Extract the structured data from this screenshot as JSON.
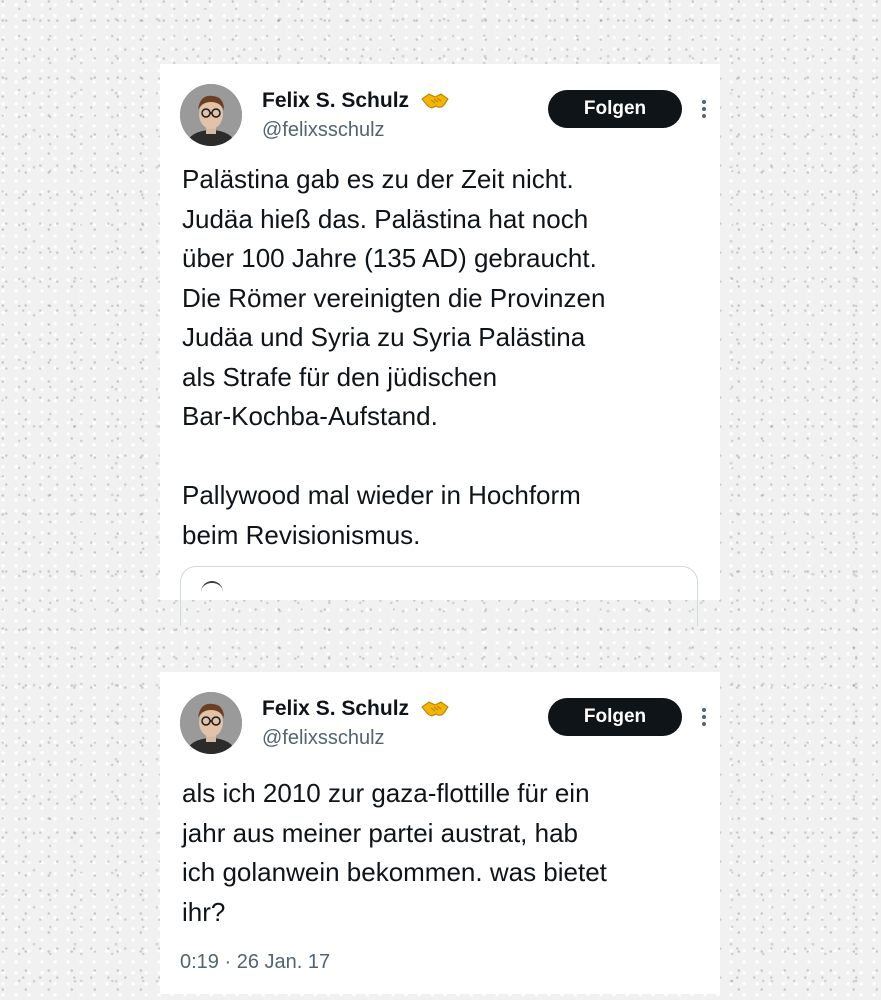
{
  "tweets": [
    {
      "author": {
        "name": "Felix S. Schulz",
        "handle": "@felixsschulz",
        "badge_icon": "handshake-icon"
      },
      "follow_label": "Folgen",
      "more_icon": "more-vertical-icon",
      "text": "Palästina gab es zu der Zeit nicht.\nJudäa hieß das. Palästina hat noch\nüber 100 Jahre (135 AD) gebraucht.\nDie Römer vereinigten die Provinzen\nJudäa und Syria zu Syria Palästina\nals Strafe für den jüdischen\nBar-Kochba-Aufstand.\n\nPallywood mal wieder in Hochform\nbeim Revisionismus."
    },
    {
      "author": {
        "name": "Felix S. Schulz",
        "handle": "@felixsschulz",
        "badge_icon": "handshake-icon"
      },
      "follow_label": "Folgen",
      "more_icon": "more-vertical-icon",
      "text": "als ich 2010 zur gaza-flottille für ein\njahr aus meiner partei austrat, hab\nich golanwein bekommen. was bietet\nihr?",
      "timestamp": "0:19 · 26 Jan. 17"
    }
  ],
  "colors": {
    "text_primary": "#0f1419",
    "text_secondary": "#536471",
    "button_bg": "#0f1419",
    "button_text": "#ffffff",
    "badge": "#f4b400"
  }
}
